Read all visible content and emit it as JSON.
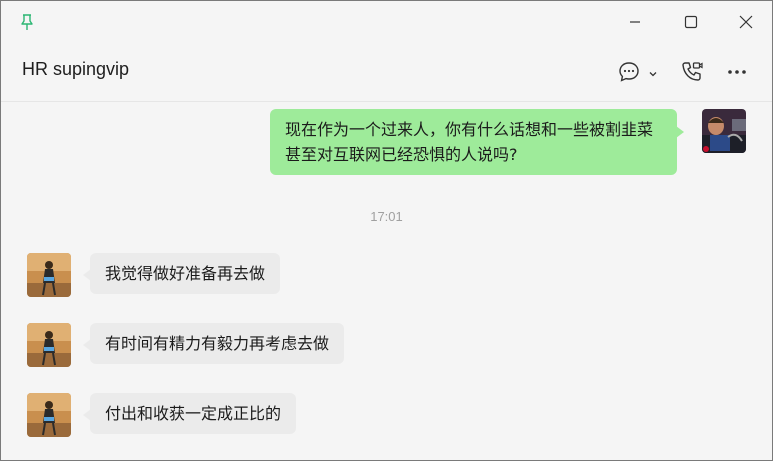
{
  "header": {
    "chat_title": "HR supingvip"
  },
  "icons": {
    "pin": "pin-icon",
    "minimize": "minimize-icon",
    "maximize": "maximize-icon",
    "close": "close-icon",
    "chat": "chat-bubble-icon",
    "chevron": "chevron-down-icon",
    "call": "phone-video-icon",
    "more": "more-icon"
  },
  "messages": {
    "outgoing_1": "现在作为一个过来人，你有什么话想和一些被割韭菜甚至对互联网已经恐惧的人说吗?",
    "timestamp": "17:01",
    "incoming_1": "我觉得做好准备再去做",
    "incoming_2": "有时间有精力有毅力再考虑去做",
    "incoming_3": "付出和收获一定成正比的"
  },
  "colors": {
    "outgoing_bubble": "#9eeb9a",
    "incoming_bubble": "#ebebeb",
    "pin": "#2bb673"
  }
}
